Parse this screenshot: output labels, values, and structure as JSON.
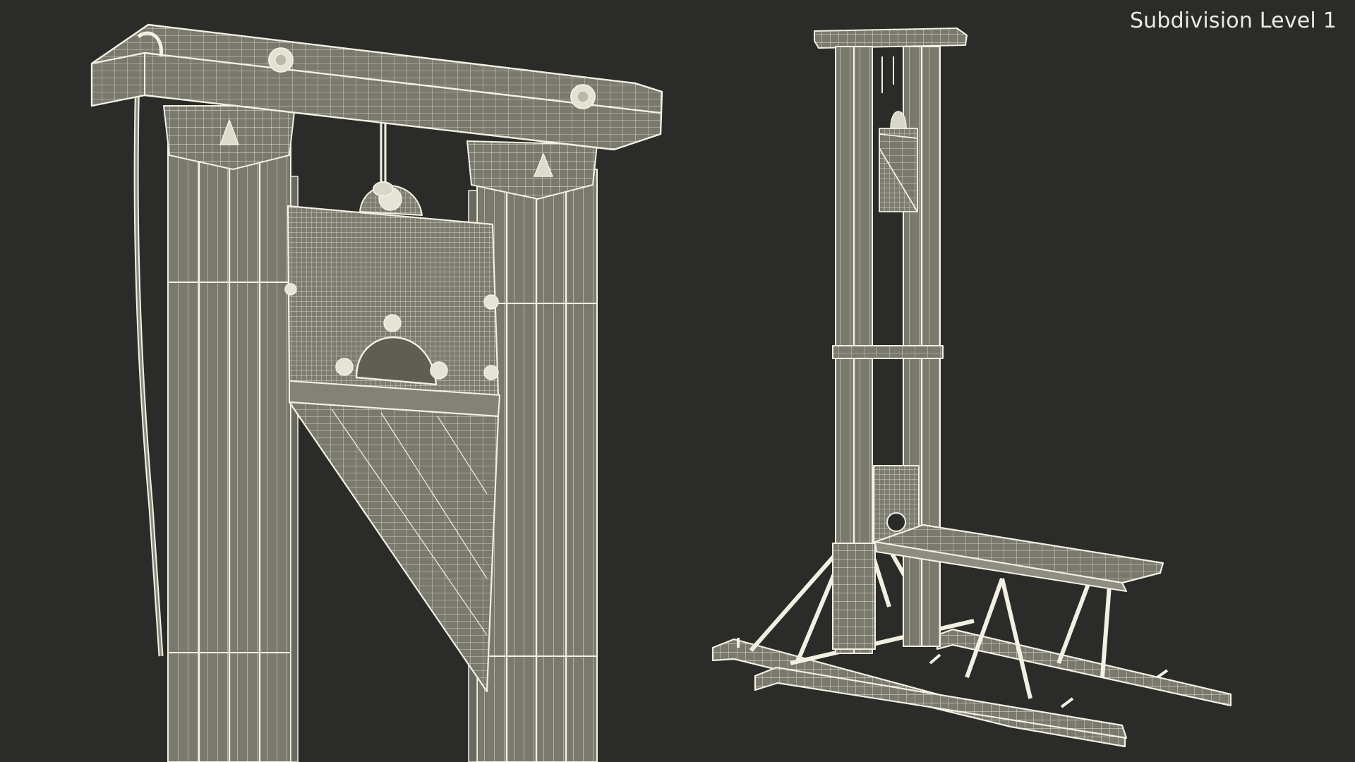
{
  "overlay": {
    "label": "Subdivision Level 1"
  },
  "colors": {
    "background": "#2b2b29",
    "wire": "#f1f0e2",
    "surface": "#767569",
    "surface_dark": "#5f5e55"
  }
}
